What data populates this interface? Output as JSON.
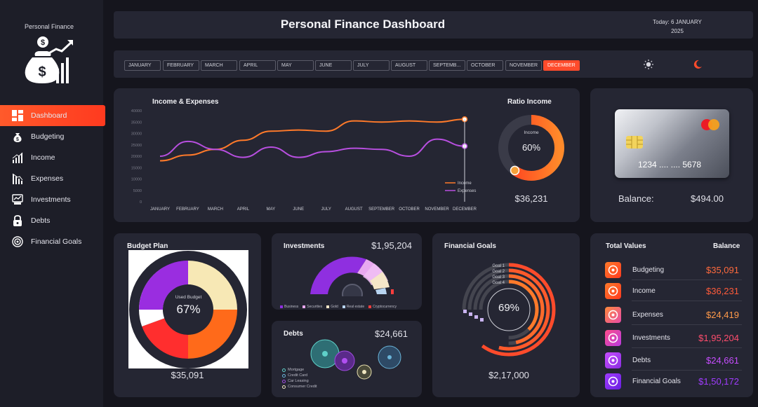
{
  "app": {
    "brand": "Personal Finance",
    "title": "Personal Finance Dashboard",
    "date_line1": "Today: 6 JANUARY",
    "date_line2": "2025"
  },
  "sidebar": {
    "items": [
      {
        "label": "Dashboard",
        "icon": "dashboard-icon",
        "active": true
      },
      {
        "label": "Budgeting",
        "icon": "money-bag-icon"
      },
      {
        "label": "Income",
        "icon": "bar-growth-icon"
      },
      {
        "label": "Expenses",
        "icon": "bar-decline-icon"
      },
      {
        "label": "Investments",
        "icon": "investment-icon"
      },
      {
        "label": "Debts",
        "icon": "lock-icon"
      },
      {
        "label": "Financial Goals",
        "icon": "target-icon"
      }
    ]
  },
  "months": [
    "JANUARY",
    "FEBRUARY",
    "MARCH",
    "APRIL",
    "MAY",
    "JUNE",
    "JULY",
    "AUGUST",
    "SEPTEMB...",
    "OCTOBER",
    "NOVEMBER",
    "DECEMBER"
  ],
  "selected_month": "DECEMBER",
  "mode_icons": [
    "sun-icon",
    "moon-icon"
  ],
  "income_expenses": {
    "title": "Income & Expenses",
    "legend_income": "Income",
    "legend_expenses": "Expenses"
  },
  "ratio_income": {
    "title": "Ratio Income",
    "center_label": "Income",
    "center_value": "60%",
    "amount": "$36,231"
  },
  "card": {
    "number": "1234 .... .... 5678",
    "balance_label": "Balance:",
    "balance_value": "$494.00"
  },
  "budget_plan": {
    "title": "Budget Plan",
    "center_label": "Used Budget",
    "center_value": "67%",
    "amount": "$35,091"
  },
  "investments": {
    "title": "Investments",
    "amount": "$1,95,204",
    "legend": [
      "Business",
      "Securities",
      "Gold",
      "Real estate",
      "Cryptocurrency"
    ]
  },
  "debts": {
    "title": "Debts",
    "amount": "$24,661",
    "legend": [
      "Mortgage",
      "Credit Card",
      "Car Leasing",
      "Consumer Credit"
    ]
  },
  "financial_goals": {
    "title": "Financial Goals",
    "center_value": "69%",
    "amount": "$2,17,000",
    "labels": [
      "Goal 1",
      "Goal 2",
      "Goal 3",
      "Goal 4"
    ]
  },
  "total_values": {
    "title": "Total Values",
    "balance_header": "Balance",
    "rows": [
      {
        "label": "Budgeting",
        "value": "$35,091",
        "color": "#ff6a3d"
      },
      {
        "label": "Income",
        "value": "$36,231",
        "color": "#ff5b3a"
      },
      {
        "label": "Expenses",
        "value": "$24,419",
        "color": "#ff9a4a"
      },
      {
        "label": "Investments",
        "value": "$1,95,204",
        "color": "#ff4d6d"
      },
      {
        "label": "Debts",
        "value": "$24,661",
        "color": "#c74dff"
      },
      {
        "label": "Financial Goals",
        "value": "$1,50,172",
        "color": "#a03cff"
      }
    ]
  },
  "colors": {
    "accent": "#ff4b2b",
    "income_line": "#ff7a2a",
    "expenses_line": "#b84fe0"
  },
  "chart_data": [
    {
      "type": "line",
      "title": "Income & Expenses",
      "categories": [
        "JANUARY",
        "FEBRUARY",
        "MARCH",
        "APRIL",
        "MAY",
        "JUNE",
        "JULY",
        "AUGUST",
        "SEPTEMBER",
        "OCTOBER",
        "NOVEMBER",
        "DECEMBER"
      ],
      "yticks": [
        0,
        5000,
        10000,
        15000,
        20000,
        25000,
        30000,
        35000,
        40000
      ],
      "ylim": [
        0,
        40000
      ],
      "series": [
        {
          "name": "Income",
          "values": [
            18000,
            20500,
            23000,
            27000,
            31000,
            31500,
            31000,
            35500,
            35000,
            35500,
            35000,
            36231
          ]
        },
        {
          "name": "Expenses",
          "values": [
            20000,
            26500,
            23000,
            19500,
            24000,
            19500,
            22000,
            23500,
            23000,
            20000,
            27500,
            24419
          ]
        }
      ]
    },
    {
      "type": "pie",
      "title": "Ratio Income",
      "values": [
        60,
        40
      ]
    },
    {
      "type": "pie",
      "title": "Budget Plan",
      "values": [
        67,
        33
      ]
    }
  ]
}
